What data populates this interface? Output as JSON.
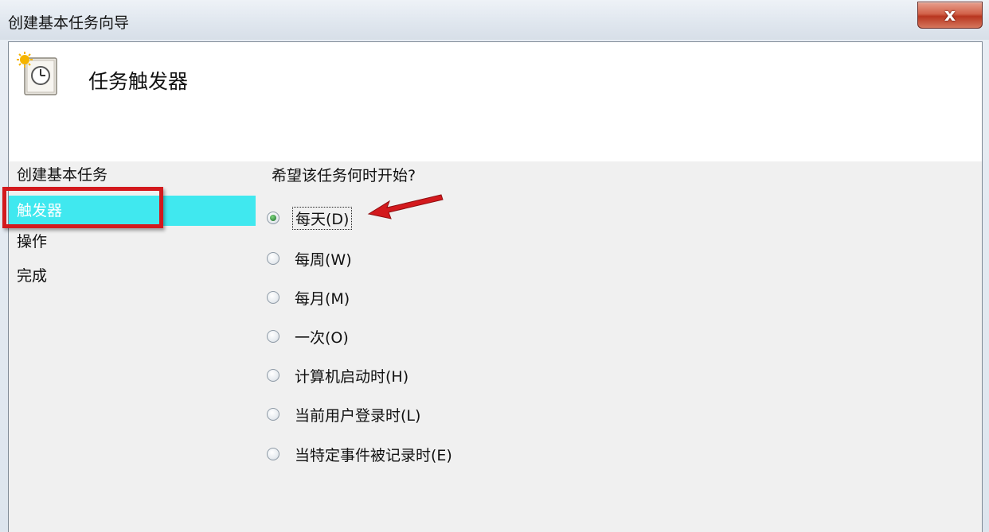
{
  "window": {
    "title": "创建基本任务向导",
    "close_label": "x"
  },
  "header": {
    "title": "任务触发器",
    "icon": "task-scheduler-clock-icon"
  },
  "sidebar": {
    "items": [
      {
        "label": "创建基本任务"
      },
      {
        "label": "触发器",
        "active": true
      },
      {
        "label": "操作"
      },
      {
        "label": "完成"
      }
    ]
  },
  "main": {
    "question": "希望该任务何时开始?",
    "options": [
      {
        "label": "每天(D)",
        "checked": true
      },
      {
        "label": "每周(W)",
        "checked": false
      },
      {
        "label": "每月(M)",
        "checked": false
      },
      {
        "label": "一次(O)",
        "checked": false
      },
      {
        "label": "计算机启动时(H)",
        "checked": false
      },
      {
        "label": "当前用户登录时(L)",
        "checked": false
      },
      {
        "label": "当特定事件被记录时(E)",
        "checked": false
      }
    ]
  },
  "colors": {
    "active_item_bg": "#40e8ef",
    "highlight_border": "#d3191d",
    "arrow": "#d3191d"
  }
}
